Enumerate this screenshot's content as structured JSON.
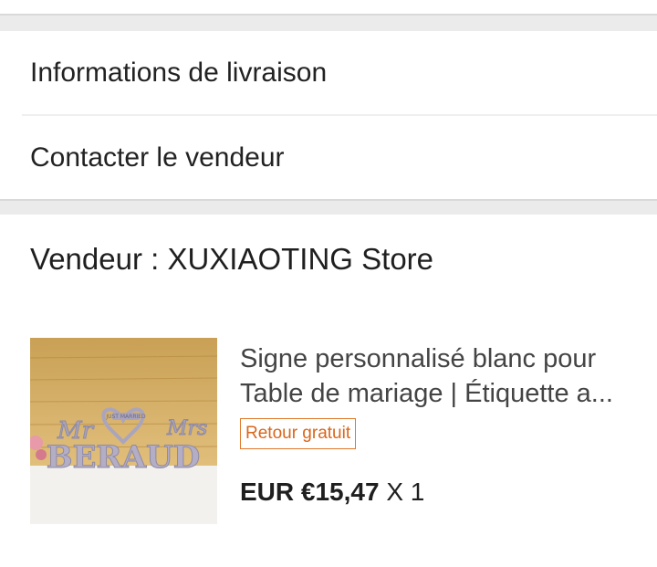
{
  "sections": {
    "delivery_label": "Informations de livraison",
    "contact_label": "Contacter le vendeur"
  },
  "seller": {
    "label": "Vendeur : XUXIAOTING Store"
  },
  "product": {
    "title": "Signe personnalisé blanc pour Table de mariage | Étiquette a...",
    "badge": "Retour gratuit",
    "price": "EUR €15,47",
    "quantity": "X 1",
    "image": {
      "top_text": "JUST MARRIED",
      "left_script": "Mr",
      "right_script": "Mrs",
      "name": "BERAUD"
    }
  },
  "colors": {
    "badge": "#e1792b",
    "separator": "#ebebeb"
  }
}
